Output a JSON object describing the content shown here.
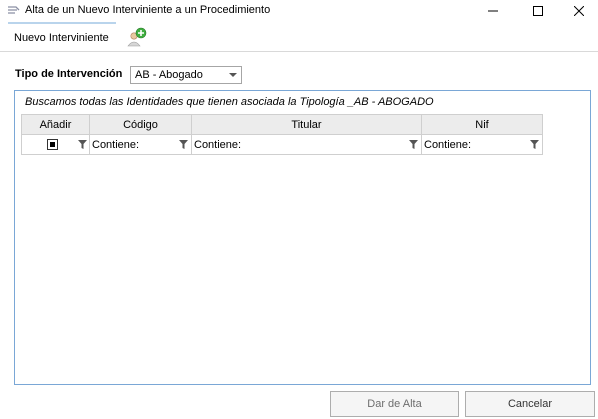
{
  "window": {
    "title": "Alta de un Nuevo Interviniente a un Procedimiento",
    "icons": {
      "app": "app-icon",
      "minimize": "minimize-icon",
      "maximize": "maximize-icon",
      "close": "close-icon"
    }
  },
  "ribbon": {
    "tab_label": "Nuevo Interviniente",
    "add_icon": "add-person-icon"
  },
  "form": {
    "tipo_label": "Tipo de Intervención",
    "tipo_value": "AB - Abogado"
  },
  "panel": {
    "caption": "Buscamos todas las Identidades que tienen asociada la Tipología _AB - ABOGADO"
  },
  "grid": {
    "columns": [
      "Añadir",
      "Código",
      "Titular",
      "Nif"
    ],
    "filter_text": "Contiene:"
  },
  "buttons": {
    "dar_alta": "Dar de Alta",
    "cancelar": "Cancelar"
  },
  "colors": {
    "accent": "#7aa7d6",
    "tab_accent": "#b9d4ec",
    "header_bg": "#ececec"
  }
}
